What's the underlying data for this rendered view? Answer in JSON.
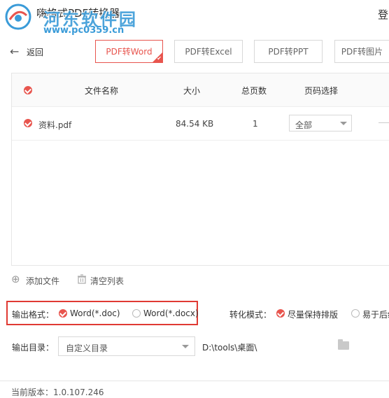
{
  "window": {
    "title": "嗨格式PDF转换器",
    "corner_text": "登",
    "watermark_name": "河东软件园",
    "watermark_url": "www.pc0359.cn"
  },
  "nav": {
    "back_label": "返回",
    "tabs": [
      {
        "label": "PDF转Word",
        "active": true
      },
      {
        "label": "PDF转Excel",
        "active": false
      },
      {
        "label": "PDF转PPT",
        "active": false
      },
      {
        "label": "PDF转图片",
        "active": false
      }
    ]
  },
  "table": {
    "headers": {
      "name": "文件名称",
      "size": "大小",
      "pages": "总页数",
      "page_select": "页码选择"
    },
    "rows": [
      {
        "name": "资料.pdf",
        "size": "84.54 KB",
        "pages": "1",
        "page_select": "全部"
      }
    ]
  },
  "actions": {
    "add_file": "添加文件",
    "clear_list": "清空列表"
  },
  "options": {
    "output_format_label": "输出格式：",
    "format_options": [
      {
        "label": "Word(*.doc)",
        "selected": true
      },
      {
        "label": "Word(*.docx)",
        "selected": false
      }
    ],
    "convert_mode_label": "转化模式：",
    "mode_options": [
      {
        "label": "尽量保持排版",
        "selected": true
      },
      {
        "label": "易于后续",
        "selected": false
      }
    ],
    "output_dir_label": "输出目录：",
    "output_dir_select": "自定义目录",
    "output_dir_path": "D:\\tools\\桌面\\"
  },
  "footer": {
    "version": "当前版本：1.0.107.246"
  },
  "colors": {
    "accent": "#e8554e",
    "highlight_box": "#e03a33",
    "watermark": "#3a9bd8"
  }
}
